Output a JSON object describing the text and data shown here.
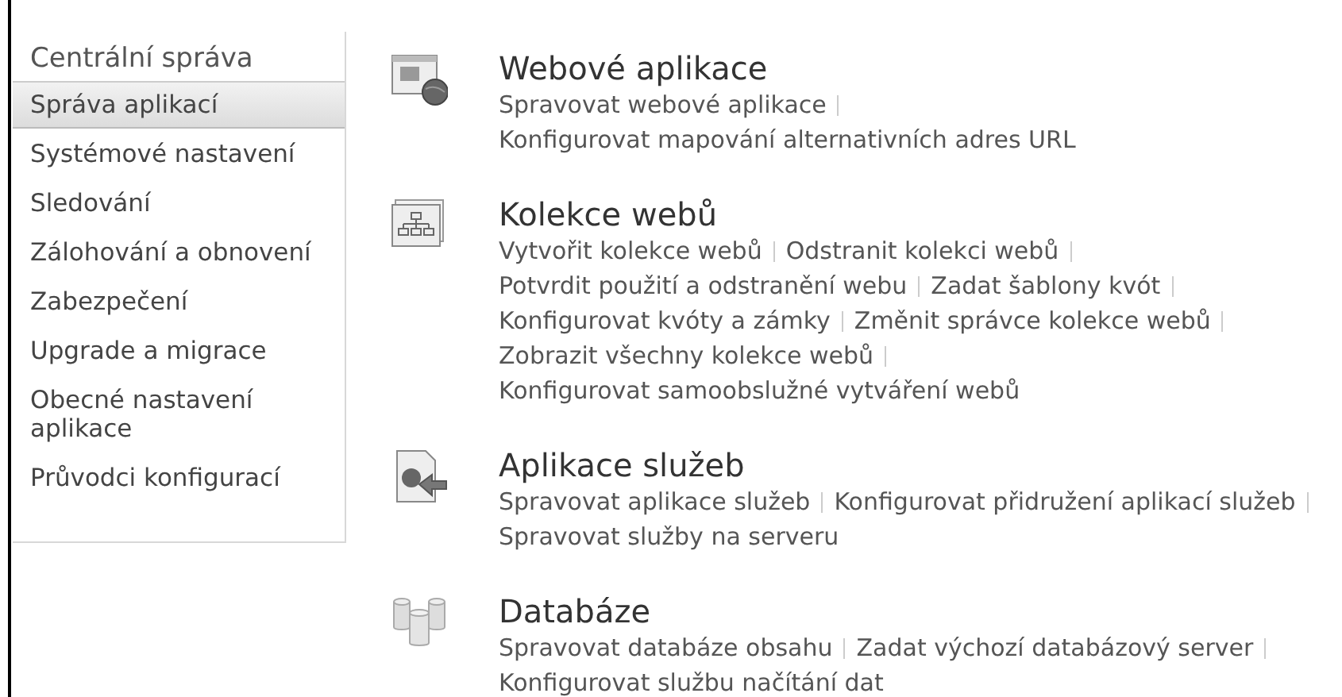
{
  "sidebar": {
    "heading": "Centrální správa",
    "items": [
      {
        "label": "Správa aplikací",
        "selected": true
      },
      {
        "label": "Systémové nastavení",
        "selected": false
      },
      {
        "label": "Sledování",
        "selected": false
      },
      {
        "label": "Zálohování a obnovení",
        "selected": false
      },
      {
        "label": "Zabezpečení",
        "selected": false
      },
      {
        "label": "Upgrade a migrace",
        "selected": false
      },
      {
        "label": "Obecné nastavení aplikace",
        "selected": false
      },
      {
        "label": "Průvodci konfigurací",
        "selected": false
      }
    ]
  },
  "sections": [
    {
      "kind": "web-apps",
      "title": "Webové aplikace",
      "lines": [
        [
          {
            "text": "Spravovat webové aplikace",
            "separator": true
          }
        ],
        [
          {
            "text": "Konfigurovat mapování alternativních adres URL",
            "separator": false
          }
        ]
      ]
    },
    {
      "kind": "site-collections",
      "title": "Kolekce webů",
      "lines": [
        [
          {
            "text": "Vytvořit kolekce webů",
            "separator": true
          },
          {
            "text": "Odstranit kolekci webů",
            "separator": true
          }
        ],
        [
          {
            "text": "Potvrdit použití a odstranění webu",
            "separator": true
          },
          {
            "text": "Zadat šablony kvót",
            "separator": true
          }
        ],
        [
          {
            "text": "Konfigurovat kvóty a zámky",
            "separator": true
          },
          {
            "text": "Změnit správce kolekce webů",
            "separator": true
          }
        ],
        [
          {
            "text": "Zobrazit všechny kolekce webů",
            "separator": true
          }
        ],
        [
          {
            "text": "Konfigurovat samoobslužné vytváření webů",
            "separator": false
          }
        ]
      ]
    },
    {
      "kind": "service-apps",
      "title": "Aplikace služeb",
      "lines": [
        [
          {
            "text": "Spravovat aplikace služeb",
            "separator": true
          },
          {
            "text": "Konfigurovat přidružení aplikací služeb",
            "separator": true
          }
        ],
        [
          {
            "text": "Spravovat služby na serveru",
            "separator": false
          }
        ]
      ]
    },
    {
      "kind": "databases",
      "title": "Databáze",
      "lines": [
        [
          {
            "text": "Spravovat databáze obsahu",
            "separator": true
          },
          {
            "text": "Zadat výchozí databázový server",
            "separator": true
          }
        ],
        [
          {
            "text": "Konfigurovat službu načítání dat",
            "separator": false
          }
        ]
      ]
    }
  ]
}
